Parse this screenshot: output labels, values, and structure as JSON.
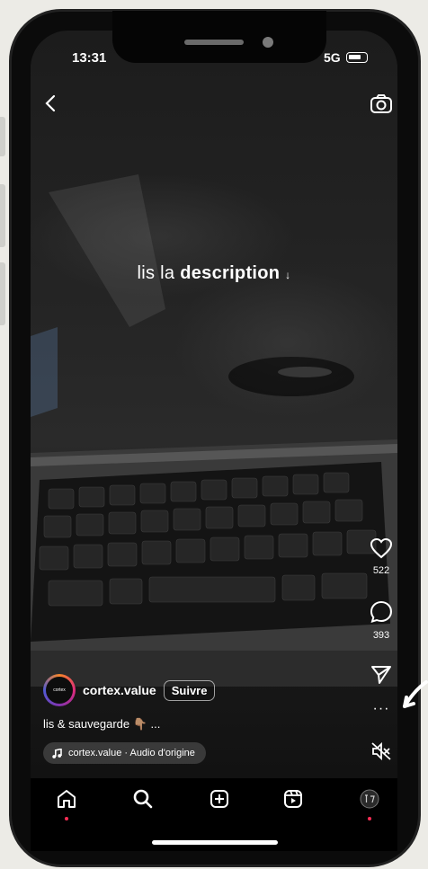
{
  "status_bar": {
    "time": "13:31",
    "network": "5G"
  },
  "overlay": {
    "text_normal": "lis la ",
    "text_bold": "description",
    "arrow": "↓"
  },
  "actions": {
    "likes": "522",
    "comments": "393"
  },
  "post": {
    "avatar_text": "cortex",
    "username": "cortex.value",
    "follow_label": "Suivre",
    "caption": "lis & sauvegarde 👇🏽 ...",
    "audio": "cortex.value · Audio d'origine"
  },
  "colors": {
    "screen_bg": "#1c1c1c",
    "notification_dot": "#ff2d55"
  }
}
